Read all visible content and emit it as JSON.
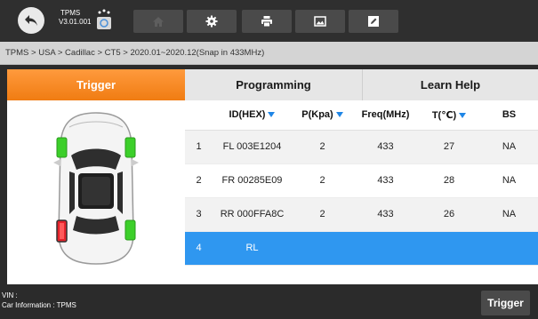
{
  "app": {
    "name": "TPMS",
    "version": "V3.01.001"
  },
  "toolbar": {
    "buttons": [
      "home-icon",
      "gear-icon",
      "printer-icon",
      "image-icon",
      "edit-icon"
    ]
  },
  "breadcrumb": "TPMS > USA > Cadillac > CT5 > 2020.01~2020.12(Snap in 433MHz)",
  "tabs": [
    {
      "label": "Trigger",
      "active": true
    },
    {
      "label": "Programming",
      "active": false
    },
    {
      "label": "Learn Help",
      "active": false
    }
  ],
  "table": {
    "headers": {
      "num": "",
      "id": "ID(HEX)",
      "p": "P(Kpa)",
      "freq": "Freq(MHz)",
      "t": "T(℃)",
      "bs": "BS"
    },
    "rows": [
      {
        "num": "1",
        "id": "FL  003E1204",
        "p": "2",
        "freq": "433",
        "t": "27",
        "bs": "NA"
      },
      {
        "num": "2",
        "id": "FR  00285E09",
        "p": "2",
        "freq": "433",
        "t": "28",
        "bs": "NA"
      },
      {
        "num": "3",
        "id": "RR  000FFA8C",
        "p": "2",
        "freq": "433",
        "t": "26",
        "bs": "NA"
      },
      {
        "num": "4",
        "id": "RL",
        "p": "",
        "freq": "",
        "t": "",
        "bs": ""
      }
    ]
  },
  "tires": {
    "front_left": "green",
    "front_right": "green",
    "rear_right": "green",
    "rear_left": "red"
  },
  "colors": {
    "accent_orange": "#f58a1f",
    "selected_blue": "#2f97f0",
    "ok_green": "#3ccf2a",
    "warn_red": "#e4232b"
  },
  "bottom": {
    "vin": "VIN :",
    "car_info": "Car Information : TPMS",
    "trigger_label": "Trigger"
  }
}
